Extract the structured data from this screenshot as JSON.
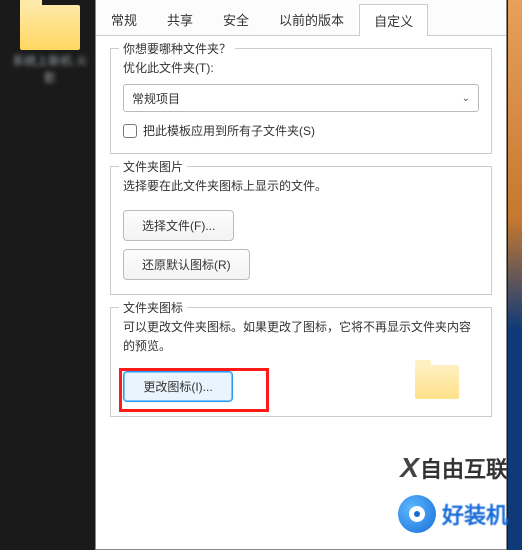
{
  "desktop": {
    "folder_label": "系统上新机\n火影"
  },
  "tabs": {
    "items": [
      "常规",
      "共享",
      "安全",
      "以前的版本",
      "自定义"
    ],
    "active_index": 4
  },
  "section1": {
    "legend": "你想要哪种文件夹？",
    "optimize_label": "优化此文件夹(T):",
    "select_value": "常规项目",
    "checkbox_label": "把此模板应用到所有子文件夹(S)"
  },
  "section2": {
    "legend": "文件夹图片",
    "desc": "选择要在此文件夹图标上显示的文件。",
    "choose_file_btn": "选择文件(F)...",
    "restore_btn": "还原默认图标(R)"
  },
  "section3": {
    "legend": "文件夹图标",
    "desc": "可以更改文件夹图标。如果更改了图标，它将不再显示文件夹内容的预览。",
    "change_icon_btn": "更改图标(I)..."
  },
  "watermarks": {
    "wm1": "自由互联",
    "wm2": "好装机"
  }
}
